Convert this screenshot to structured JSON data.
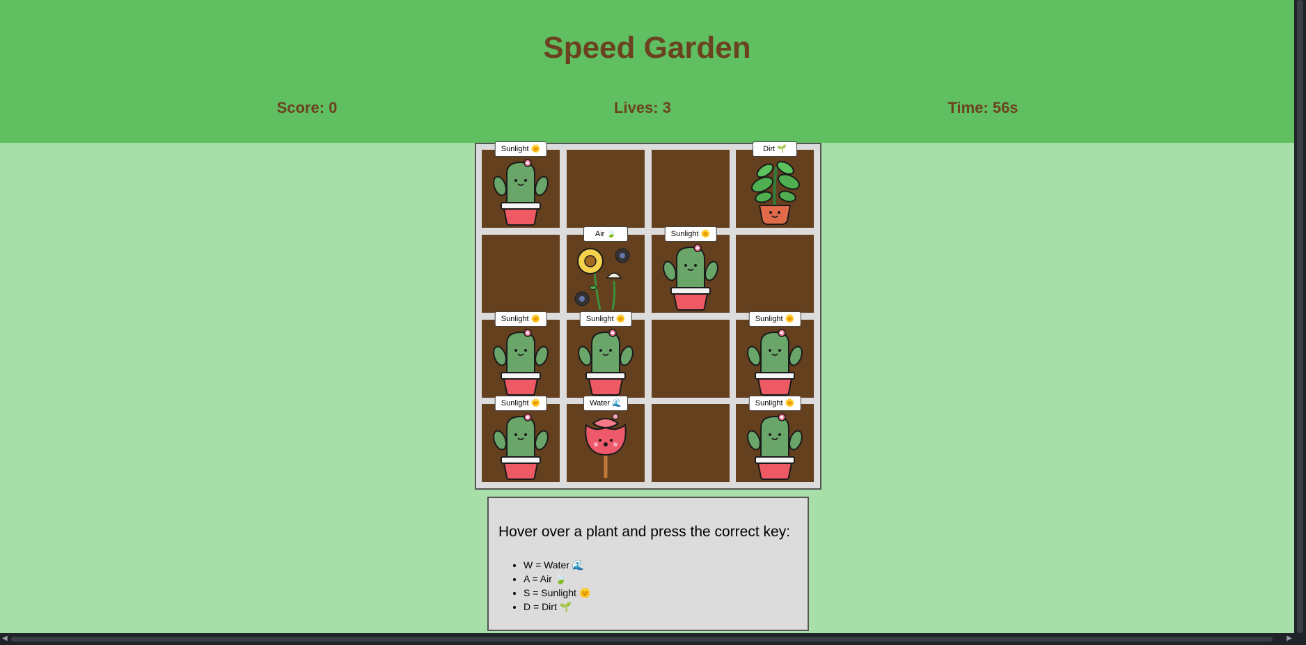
{
  "header": {
    "title": "Speed Garden",
    "score": "Score: 0",
    "lives": "Lives: 3",
    "time": "Time: 56s"
  },
  "grid": {
    "cells": [
      {
        "label": "Sunlight 🌞",
        "plant": "cactus"
      },
      {
        "label": "",
        "plant": ""
      },
      {
        "label": "",
        "plant": ""
      },
      {
        "label": "Dirt 🌱",
        "plant": "leafy"
      },
      {
        "label": "",
        "plant": ""
      },
      {
        "label": "Air 🍃",
        "plant": "sunflower"
      },
      {
        "label": "Sunlight 🌞",
        "plant": "cactus"
      },
      {
        "label": "",
        "plant": ""
      },
      {
        "label": "Sunlight 🌞",
        "plant": "cactus"
      },
      {
        "label": "Sunlight 🌞",
        "plant": "cactus"
      },
      {
        "label": "",
        "plant": ""
      },
      {
        "label": "Sunlight 🌞",
        "plant": "cactus"
      },
      {
        "label": "Sunlight 🌞",
        "plant": "cactus"
      },
      {
        "label": "Water 🌊",
        "plant": "rose"
      },
      {
        "label": "",
        "plant": ""
      },
      {
        "label": "Sunlight 🌞",
        "plant": "cactus"
      }
    ]
  },
  "instructions": {
    "title": "Hover over a plant and press the correct key:",
    "keys": [
      "W = Water 🌊",
      "A = Air 🍃",
      "S = Sunlight 🌞",
      "D = Dirt 🌱"
    ]
  },
  "colors": {
    "header_bg": "#60bf60",
    "page_bg": "#a8dfa8",
    "title_text": "#6b4220",
    "soil": "#65401f",
    "grid_bg": "#dcdcdc"
  }
}
